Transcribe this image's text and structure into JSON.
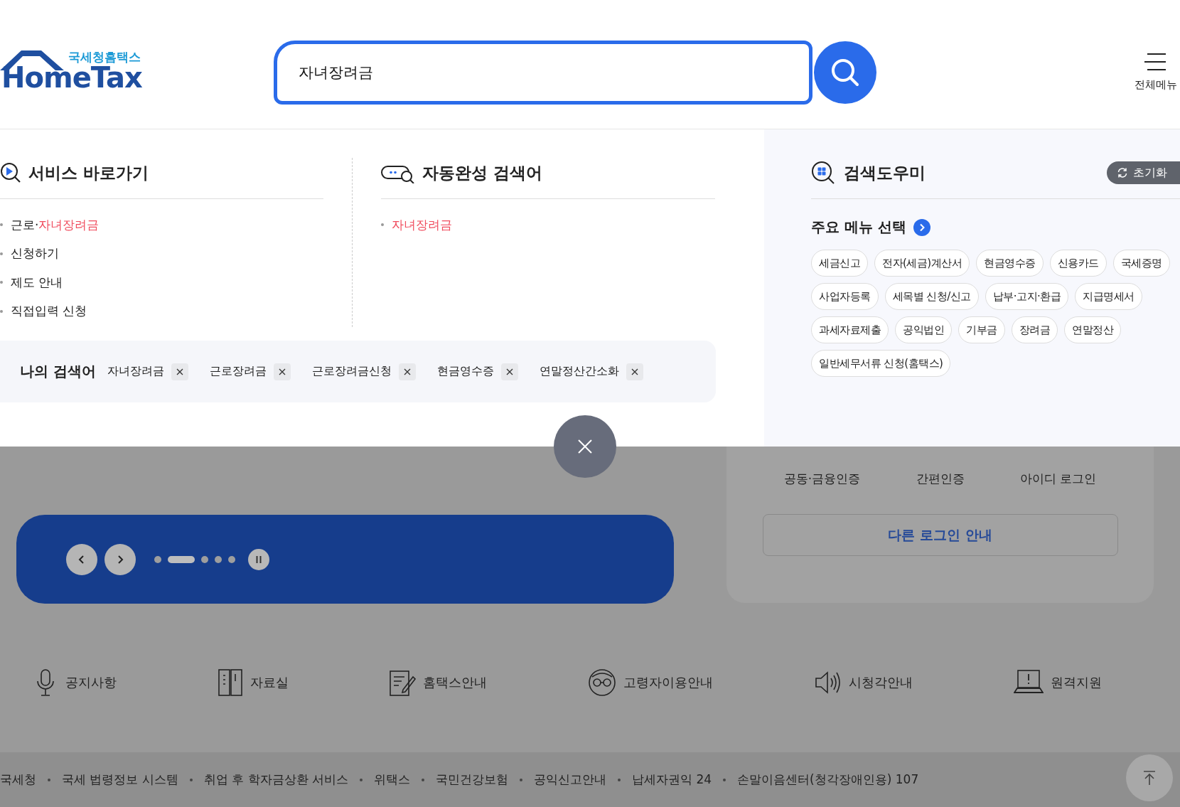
{
  "header": {
    "logo": {
      "subtitle": "국세청홈택스",
      "title": "HomeTax"
    },
    "search": {
      "value": "자녀장려금"
    },
    "menu_label": "전체메뉴"
  },
  "service_shortcuts": {
    "title": "서비스 바로가기",
    "items": [
      {
        "parts": [
          {
            "text": "근로·",
            "highlight": false
          },
          {
            "text": "자녀장려금",
            "highlight": true
          }
        ]
      },
      {
        "parts": [
          {
            "text": "신청하기",
            "highlight": false
          }
        ]
      },
      {
        "parts": [
          {
            "text": "제도 안내",
            "highlight": false
          }
        ]
      },
      {
        "parts": [
          {
            "text": "직접입력 신청",
            "highlight": false
          }
        ]
      }
    ]
  },
  "autocomplete": {
    "title": "자동완성 검색어",
    "items": [
      {
        "parts": [
          {
            "text": "자녀장려금",
            "highlight": true
          }
        ]
      }
    ]
  },
  "my_searches": {
    "title": "나의 검색어",
    "items": [
      "자녀장려금",
      "근로장려금",
      "근로장려금신청",
      "현금영수증",
      "연말정산간소화"
    ]
  },
  "search_helper": {
    "title": "검색도우미",
    "reset_label": "초기화",
    "main_menu_title": "주요 메뉴 선택",
    "tags": [
      "세금신고",
      "전자(세금)계산서",
      "현금영수증",
      "신용카드",
      "국세증명",
      "사업자등록",
      "세목별 신청/신고",
      "납부·고지·환급",
      "지급명세서",
      "과세자료제출",
      "공익법인",
      "기부금",
      "장려금",
      "연말정산",
      "일반세무서류 신청(홈택스)"
    ]
  },
  "login_card": {
    "methods": [
      "공동·금융인증",
      "간편인증",
      "아이디 로그인"
    ],
    "other_login": "다른 로그인 안내"
  },
  "banner": {
    "slides": [
      {
        "selected": false
      },
      {
        "selected": true
      },
      {
        "selected": false
      },
      {
        "selected": false
      },
      {
        "selected": false
      }
    ]
  },
  "quick_links": [
    {
      "kind": "mic",
      "label": "공지사항"
    },
    {
      "kind": "library",
      "label": "자료실"
    },
    {
      "kind": "document",
      "label": "홈택스안내"
    },
    {
      "kind": "senior",
      "label": "고령자이용안내"
    },
    {
      "kind": "speaker",
      "label": "시청각안내"
    },
    {
      "kind": "remote",
      "label": "원격지원"
    }
  ],
  "footer_links": [
    "국세청",
    "국세 법령정보 시스템",
    "취업 후 학자금상환 서비스",
    "위택스",
    "국민건강보험",
    "공익신고안내",
    "납세자권익 24",
    "손말이음센터(청각장애인용) 107"
  ]
}
